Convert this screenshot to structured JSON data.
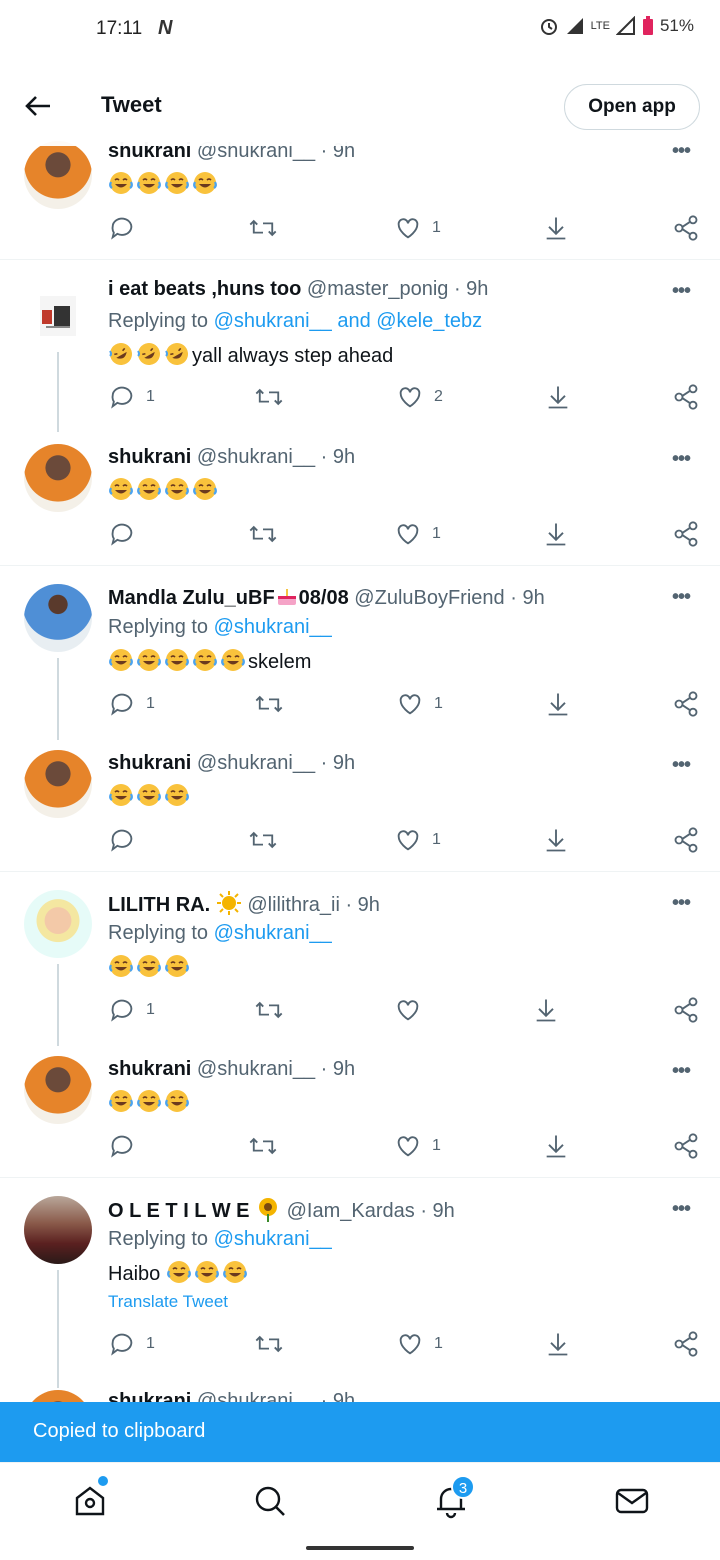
{
  "status_bar": {
    "time": "17:11",
    "network_label": "LTE",
    "battery": "51%"
  },
  "header": {
    "title": "Tweet",
    "open_app": "Open app"
  },
  "tweets": [
    {
      "name": "shukrani",
      "handle": "@shukrani__",
      "time": "· 9h",
      "replying": "",
      "text": "",
      "emoji_count": 4,
      "emoji": "tears-of-joy",
      "replies": "",
      "likes": "1"
    },
    {
      "name": "i eat beats ,huns too",
      "handle": "@master_ponig",
      "time": "· 9h",
      "replying_prefix": "Replying to",
      "replying_links": "@shukrani__ and @kele_tebz",
      "text": "yall always step ahead",
      "emoji_count": 3,
      "emoji": "rolling-laughing",
      "replies": "1",
      "likes": "2"
    },
    {
      "name": "shukrani",
      "handle": "@shukrani__",
      "time": "· 9h",
      "text": "",
      "emoji_count": 4,
      "emoji": "tears-of-joy",
      "replies": "",
      "likes": "1"
    },
    {
      "name": "Mandla Zulu_uBF",
      "name_suffix": "08/08",
      "handle": "@ZuluBoyFriend",
      "time": "· 9h",
      "replying_prefix": "Replying to",
      "replying_links": "@shukrani__",
      "text": "skelem",
      "emoji_count": 5,
      "emoji": "tears-of-joy",
      "replies": "1",
      "likes": "1"
    },
    {
      "name": "shukrani",
      "handle": "@shukrani__",
      "time": "· 9h",
      "text": "",
      "emoji_count": 3,
      "emoji": "tears-of-joy",
      "replies": "",
      "likes": "1"
    },
    {
      "name": "LILITH RA.",
      "handle": "@lilithra_ii",
      "time": "· 9h",
      "replying_prefix": "Replying to",
      "replying_links": "@shukrani__",
      "text": "",
      "emoji_count": 3,
      "emoji": "tears-of-joy",
      "replies": "1",
      "likes": ""
    },
    {
      "name": "shukrani",
      "handle": "@shukrani__",
      "time": "· 9h",
      "text": "",
      "emoji_count": 3,
      "emoji": "tears-of-joy",
      "replies": "",
      "likes": "1"
    },
    {
      "name": "O L E T I L W E",
      "handle": "@Iam_Kardas",
      "time": "· 9h",
      "replying_prefix": "Replying to",
      "replying_links": "@shukrani__",
      "text": "Haibo",
      "emoji_count": 3,
      "emoji": "tears-of-joy",
      "translate": "Translate Tweet",
      "replies": "1",
      "likes": "1"
    },
    {
      "name": "shukrani",
      "handle": "@shukrani__",
      "time": "· 9h"
    }
  ],
  "toast": {
    "text": "Copied to clipboard"
  },
  "bottom_nav": {
    "notifications_count": "3",
    "items": [
      "home-icon",
      "search-icon",
      "notifications-icon",
      "messages-icon"
    ]
  },
  "colors": {
    "accent": "#1d9bf0",
    "text_primary": "#0f1419",
    "text_secondary": "#536471"
  }
}
